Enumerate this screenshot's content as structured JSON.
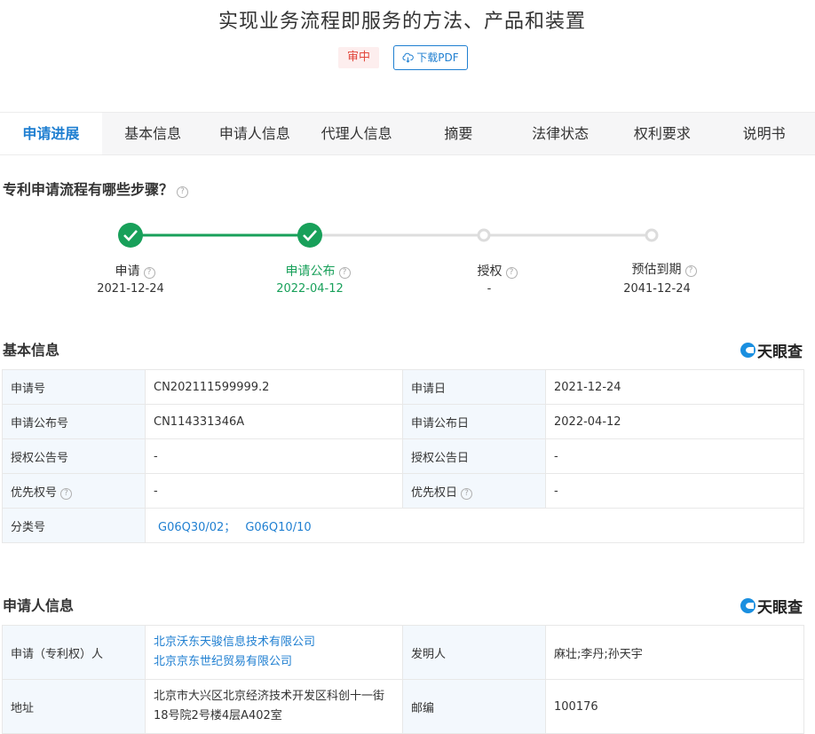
{
  "header": {
    "title": "实现业务流程即服务的方法、产品和装置",
    "status": "审中",
    "pdf_label": "下载PDF"
  },
  "tabs": [
    {
      "label": "申请进展",
      "active": true
    },
    {
      "label": "基本信息"
    },
    {
      "label": "申请人信息"
    },
    {
      "label": "代理人信息"
    },
    {
      "label": "摘要"
    },
    {
      "label": "法律状态"
    },
    {
      "label": "权利要求"
    },
    {
      "label": "说明书"
    }
  ],
  "process": {
    "question": "专利申请流程有哪些步骤？",
    "steps": [
      {
        "label": "申请",
        "date": "2021-12-24",
        "done": true
      },
      {
        "label": "申请公布",
        "date": "2022-04-12",
        "done": true
      },
      {
        "label": "授权",
        "date": "-",
        "done": false
      },
      {
        "label": "预估到期",
        "date": "2041-12-24",
        "done": false
      }
    ]
  },
  "basic_info": {
    "title": "基本信息",
    "logo_text": "天眼查",
    "rows": [
      {
        "l1": "申请号",
        "v1": "CN202111599999.2",
        "l2": "申请日",
        "v2": "2021-12-24"
      },
      {
        "l1": "申请公布号",
        "v1": "CN114331346A",
        "l2": "申请公布日",
        "v2": "2022-04-12"
      },
      {
        "l1": "授权公告号",
        "v1": "-",
        "l2": "授权公告日",
        "v2": "-"
      },
      {
        "l1": "优先权号",
        "v1": "-",
        "l2": "优先权日",
        "v2": "-"
      }
    ],
    "class_label": "分类号",
    "class_values": [
      "G06Q30/02；",
      "G06Q10/10"
    ]
  },
  "applicant_info": {
    "title": "申请人信息",
    "logo_text": "天眼查",
    "applicant_label": "申请（专利权）人",
    "applicants": [
      "北京沃东天骏信息技术有限公司",
      "北京京东世纪贸易有限公司"
    ],
    "inventor_label": "发明人",
    "inventors": "麻壮;李丹;孙天宇",
    "address_label": "地址",
    "address": "北京市大兴区北京经济技术开发区科创十一街18号院2号楼4层A402室",
    "postcode_label": "邮编",
    "postcode": "100176"
  },
  "colors": {
    "accent": "#1f7fd1",
    "done_green": "#18a05a",
    "pending_gray": "#d9d9d9",
    "status_red": "#e2483d"
  }
}
